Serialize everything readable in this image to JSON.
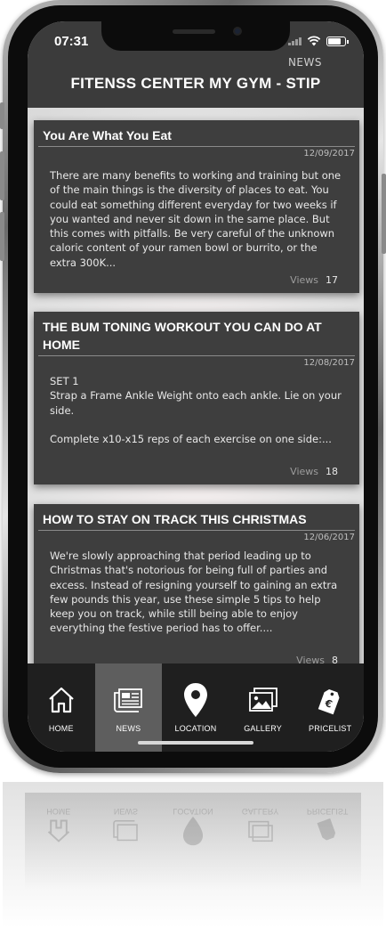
{
  "status_bar": {
    "time": "07:31"
  },
  "header": {
    "section": "NEWS",
    "title": "FITENSS CENTER MY GYM - STIP"
  },
  "articles": [
    {
      "title": "You Are What You Eat",
      "date": "12/09/2017",
      "excerpt": "There are many benefits to working and training but one of the main things is the diversity of places to eat. You could eat something different everyday for two weeks if you wanted and never sit down in the same place. But this comes with pitfalls. Be very careful of the unknown caloric content of your ramen bowl or burrito, or the extra 300K...",
      "views_label": "Views",
      "views": "17"
    },
    {
      "title": "THE BUM TONING WORKOUT YOU CAN DO AT HOME",
      "date": "12/08/2017",
      "excerpt": "SET 1\nStrap a Frame Ankle Weight onto each ankle. Lie on your side.\n\nComplete x10-x15 reps of each exercise on one side:...",
      "views_label": "Views",
      "views": "18"
    },
    {
      "title": "HOW TO STAY ON TRACK THIS CHRISTMAS",
      "date": "12/06/2017",
      "excerpt": "We're slowly approaching that period leading up to Christmas that's notorious for being full of parties and excess. Instead of resigning yourself to gaining an extra few pounds this year, use these simple 5 tips to help keep you on track, while still being able to enjoy everything the festive period has to offer....",
      "views_label": "Views",
      "views": "8"
    }
  ],
  "tabs": [
    {
      "label": "HOME",
      "icon": "home-icon",
      "active": false
    },
    {
      "label": "NEWS",
      "icon": "news-icon",
      "active": true
    },
    {
      "label": "LOCATION",
      "icon": "location-pin-icon",
      "active": false
    },
    {
      "label": "GALLERY",
      "icon": "gallery-icon",
      "active": false
    },
    {
      "label": "PRICELIST",
      "icon": "price-tag-icon",
      "active": false
    }
  ],
  "colors": {
    "bar": "#3b3b3b",
    "card": "#3e3e3e",
    "tabbar": "#1f1f1f",
    "active_tab": "#5e5e5e"
  }
}
